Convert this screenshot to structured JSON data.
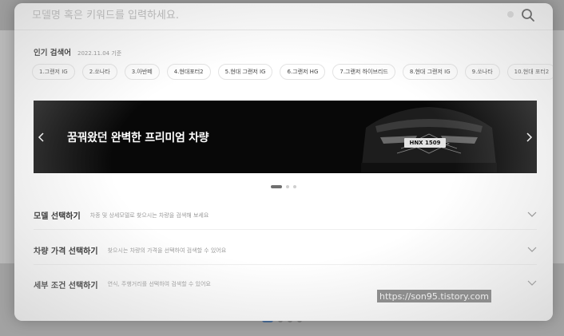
{
  "search": {
    "placeholder": "모델명 혹은 키워드를 입력하세요.",
    "button_icon": "search-icon"
  },
  "popular": {
    "title": "인기 검색어",
    "date": "2022.11.04 기준",
    "keywords": [
      "1.그랜저 IG",
      "2.쏘나타",
      "3.아반떼",
      "4.현대포터2",
      "5.현대 그랜저 IG",
      "6.그랜저 HG",
      "7.그랜저 하이브리드",
      "8.현대 그랜저 IG",
      "9.쏘나타",
      "10.현대 포터2"
    ]
  },
  "banner": {
    "headline": "꿈꿔왔던 완벽한 프리미엄 차량",
    "plate": "HNX 1509",
    "prev_icon": "chevron-left-icon",
    "next_icon": "chevron-right-icon"
  },
  "pagination": {
    "count": 3,
    "active": 1
  },
  "sections": [
    {
      "title": "모델 선택하기",
      "desc": "차종 및 상세모델로 찾으시는 차량을 검색해 보세요"
    },
    {
      "title": "차량 가격 선택하기",
      "desc": "찾으시는 차량의 가격을 선택하여 검색할 수 있어요"
    },
    {
      "title": "세부 조건 선택하기",
      "desc": "연식, 주행거리를 선택하여 검색할 수 있어요"
    }
  ],
  "watermark": "https://son95.tistory.com"
}
